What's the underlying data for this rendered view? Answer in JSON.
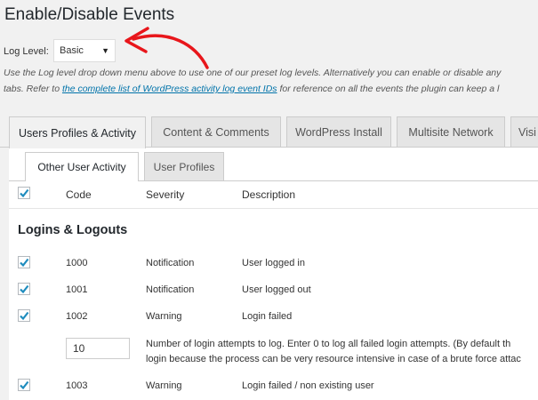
{
  "page": {
    "title": "Enable/Disable Events"
  },
  "log_level": {
    "label": "Log Level:",
    "selected": "Basic"
  },
  "description": {
    "line1": "Use the Log level drop down menu above to use one of our preset log levels. Alternatively you can enable or disable any",
    "line2_before": "tabs. Refer to ",
    "link": "the complete list of WordPress activity log event IDs",
    "line2_after": " for reference on all the events the plugin can keep a l"
  },
  "tabs": [
    {
      "label": "Users Profiles & Activity",
      "active": true
    },
    {
      "label": "Content & Comments",
      "active": false
    },
    {
      "label": "WordPress Install",
      "active": false
    },
    {
      "label": "Multisite Network",
      "active": false
    },
    {
      "label": "Visi",
      "active": false
    }
  ],
  "subtabs": [
    {
      "label": "Other User Activity",
      "active": true
    },
    {
      "label": "User Profiles",
      "active": false
    }
  ],
  "table": {
    "headers": {
      "code": "Code",
      "severity": "Severity",
      "description": "Description"
    },
    "section_title": "Logins & Logouts",
    "rows": [
      {
        "checked": true,
        "code": "1000",
        "severity": "Notification",
        "description": "User logged in"
      },
      {
        "checked": true,
        "code": "1001",
        "severity": "Notification",
        "description": "User logged out"
      },
      {
        "checked": true,
        "code": "1002",
        "severity": "Warning",
        "description": "Login failed"
      },
      {
        "checked": true,
        "code": "1003",
        "severity": "Warning",
        "description": "Login failed / non existing user"
      }
    ],
    "attempts": {
      "value": "10",
      "note_line1": "Number of login attempts to log. Enter 0 to log all failed login attempts. (By default th",
      "note_line2": "login because the process can be very resource intensive in case of a brute force attac"
    }
  },
  "colors": {
    "check": "#1e8cbe",
    "link": "#0073aa",
    "annotation_arrow": "#e8161b"
  }
}
